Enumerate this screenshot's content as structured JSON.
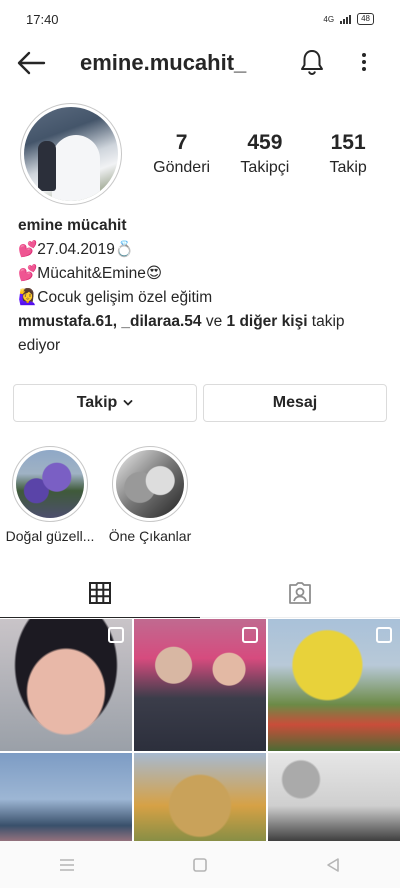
{
  "status_bar": {
    "time": "17:40",
    "network": "4G",
    "battery": "48"
  },
  "header": {
    "username": "emine.mucahit_"
  },
  "profile": {
    "stats": [
      {
        "value": "7",
        "label": "Gönderi"
      },
      {
        "value": "459",
        "label": "Takipçi"
      },
      {
        "value": "151",
        "label": "Takip"
      }
    ],
    "display_name": "emine mücahit",
    "bio_lines": [
      "💕27.04.2019💍",
      "💕Mücahit&Emine😍",
      "🙋‍♀️Cocuk gelişim özel eğitim"
    ],
    "followed_by": {
      "users": "mmustafa.61, _dilaraa.54",
      "connector": " ve ",
      "others": "1 diğer kişi",
      "suffix": " takip ediyor"
    }
  },
  "actions": {
    "follow_label": "Takip",
    "message_label": "Mesaj"
  },
  "highlights": [
    {
      "label": "Doğal güzell..."
    },
    {
      "label": "Öne Çıkanlar"
    }
  ],
  "tabs": [
    {
      "icon": "grid-icon",
      "active": true
    },
    {
      "icon": "tagged-icon",
      "active": false
    }
  ],
  "posts": [
    {
      "multi": true
    },
    {
      "multi": true
    },
    {
      "multi": true
    },
    {
      "multi": false
    },
    {
      "multi": false
    },
    {
      "multi": false
    }
  ],
  "colors": {
    "text": "#262626",
    "border": "#dbdbdb",
    "muted": "#8e8e8e"
  }
}
